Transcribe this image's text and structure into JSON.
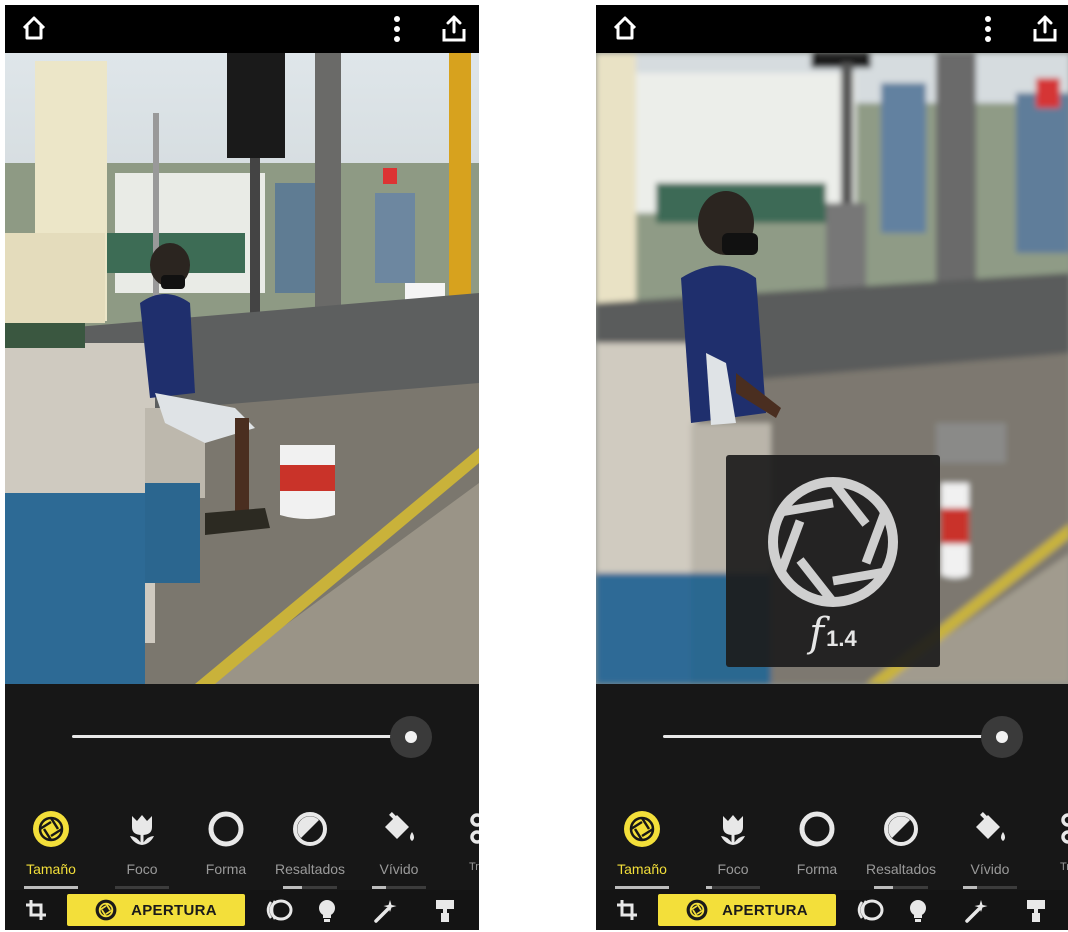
{
  "screens": [
    {
      "id": "left",
      "tools": [
        {
          "label": "Tamaño",
          "icon": "aperture-icon",
          "active": true,
          "level": 1.0
        },
        {
          "label": "Foco",
          "icon": "focus-tulip-icon",
          "active": false,
          "level": 0.0
        },
        {
          "label": "Forma",
          "icon": "circle-shape-icon",
          "active": false,
          "level": 0.0
        },
        {
          "label": "Resaltados",
          "icon": "highlights-icon",
          "active": false,
          "level": 0.35
        },
        {
          "label": "Vívido",
          "icon": "paint-bucket-icon",
          "active": false,
          "level": 0.25
        },
        {
          "label": "Transf",
          "icon": "transform-icon",
          "active": false,
          "level": 0.0
        }
      ],
      "slider_level": 1.0,
      "bottom": {
        "active_tab_label": "APERTURA"
      },
      "overlay": null
    },
    {
      "id": "right",
      "tools": [
        {
          "label": "Tamaño",
          "icon": "aperture-icon",
          "active": true,
          "level": 1.0
        },
        {
          "label": "Foco",
          "icon": "focus-tulip-icon",
          "active": false,
          "level": 0.12
        },
        {
          "label": "Forma",
          "icon": "circle-shape-icon",
          "active": false,
          "level": 0.0
        },
        {
          "label": "Resaltados",
          "icon": "highlights-icon",
          "active": false,
          "level": 0.35
        },
        {
          "label": "Vívido",
          "icon": "paint-bucket-icon",
          "active": false,
          "level": 0.25
        },
        {
          "label": "Transf",
          "icon": "transform-icon",
          "active": false,
          "level": 0.0
        }
      ],
      "slider_level": 1.0,
      "bottom": {
        "active_tab_label": "APERTURA"
      },
      "overlay": {
        "f_letter": "f",
        "f_number": "1.4",
        "icon": "aperture-icon"
      }
    }
  ],
  "colors": {
    "accent_yellow": "#f3df3a",
    "panel_dark": "#171717",
    "topbar_black": "#000000"
  }
}
